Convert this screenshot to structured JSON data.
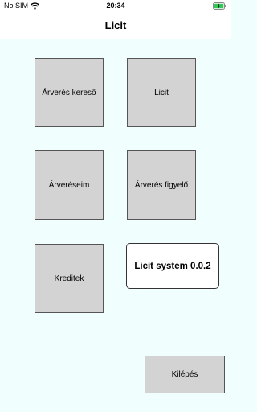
{
  "status_bar": {
    "carrier": "No SIM",
    "time": "20:34"
  },
  "nav": {
    "title": "Licit"
  },
  "tiles": {
    "auction_search": "Árverés kereső",
    "bid": "Licit",
    "my_auctions": "Árveréseim",
    "auction_watch": "Árverés figyelő",
    "credits": "Kreditek"
  },
  "version": {
    "label": "Licit system 0.0.2"
  },
  "logout": {
    "label": "Kilépés"
  },
  "icons": {
    "wifi": "wifi-icon",
    "battery": "battery-charging-icon"
  },
  "colors": {
    "background": "#f1fefe",
    "tile": "#d3d3d3",
    "battery": "#34c759"
  }
}
